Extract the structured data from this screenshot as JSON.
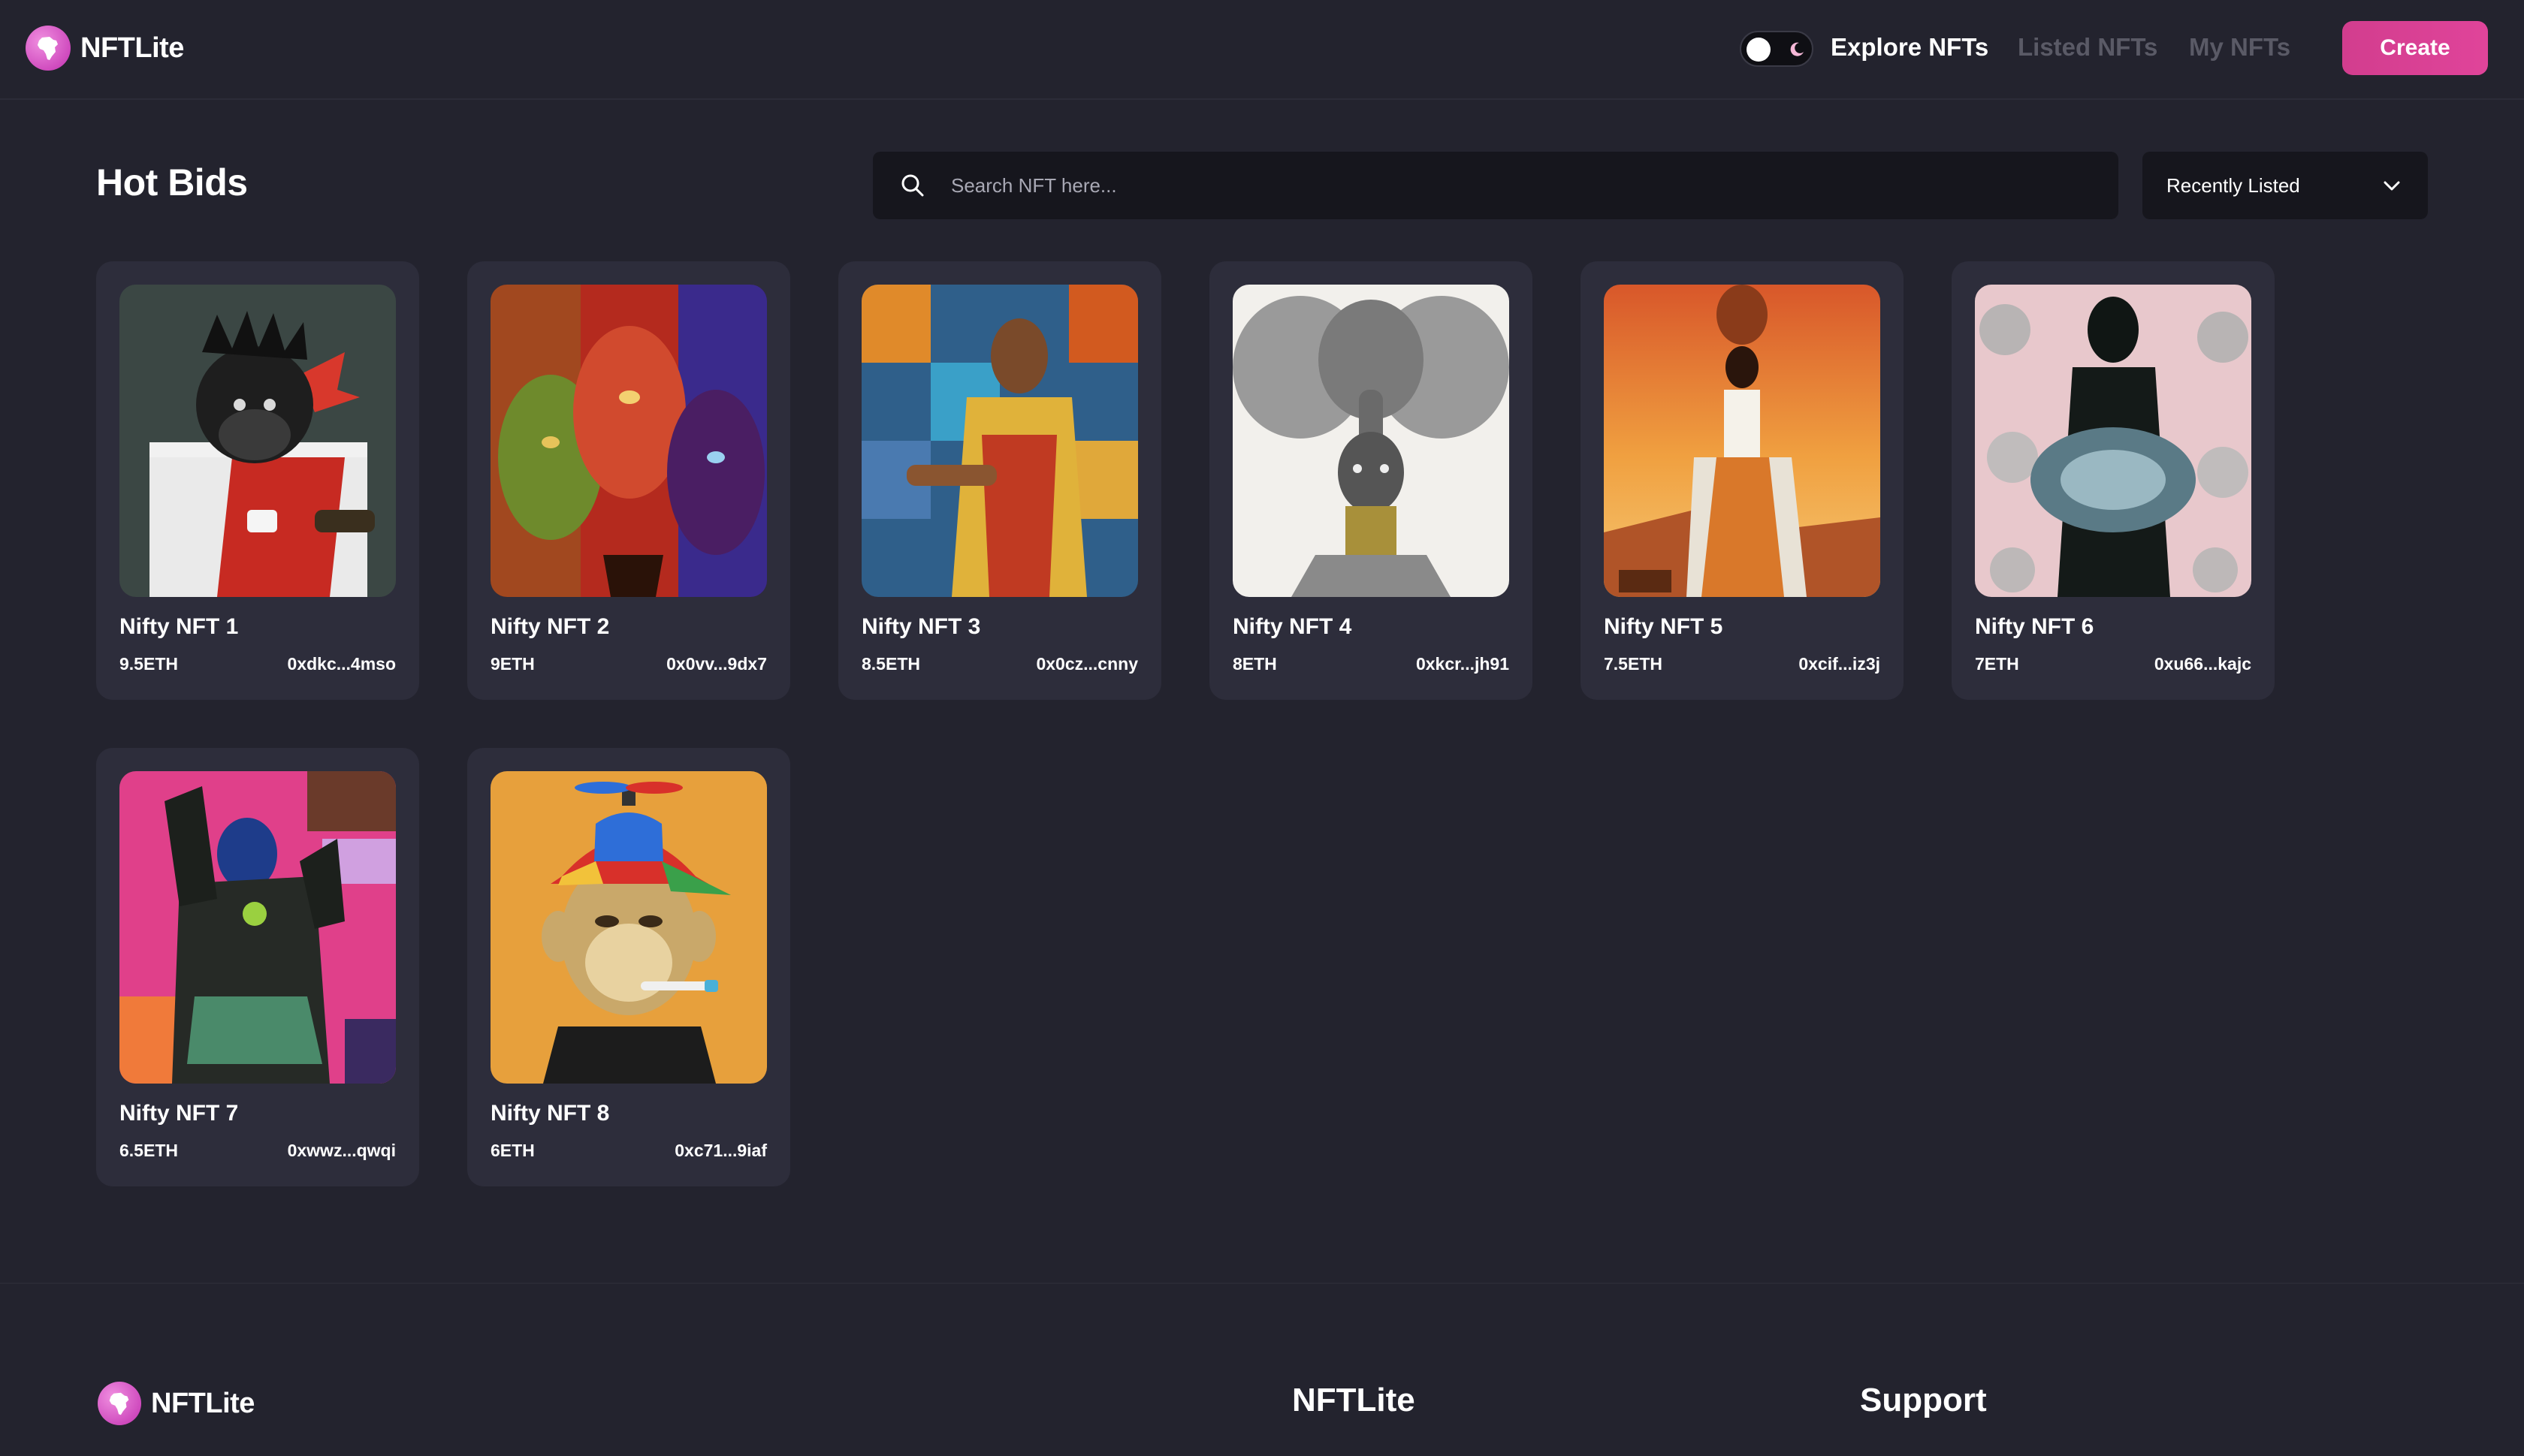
{
  "header": {
    "brand": "NFTLite",
    "nav": {
      "explore": "Explore NFTs",
      "listed": "Listed NFTs",
      "my": "My NFTs"
    },
    "create_label": "Create",
    "theme_toggle": "dark-mode-toggle"
  },
  "main": {
    "title": "Hot Bids",
    "search": {
      "placeholder": "Search NFT here...",
      "value": ""
    },
    "sort": {
      "selected": "Recently Listed"
    },
    "cards": [
      {
        "name": "Nifty NFT 1",
        "price": "9.5ETH",
        "owner": "0xdkc...4mso"
      },
      {
        "name": "Nifty NFT 2",
        "price": "9ETH",
        "owner": "0x0vv...9dx7"
      },
      {
        "name": "Nifty NFT 3",
        "price": "8.5ETH",
        "owner": "0x0cz...cnny"
      },
      {
        "name": "Nifty NFT 4",
        "price": "8ETH",
        "owner": "0xkcr...jh91"
      },
      {
        "name": "Nifty NFT 5",
        "price": "7.5ETH",
        "owner": "0xcif...iz3j"
      },
      {
        "name": "Nifty NFT 6",
        "price": "7ETH",
        "owner": "0xu66...kajc"
      },
      {
        "name": "Nifty NFT 7",
        "price": "6.5ETH",
        "owner": "0xwwz...qwqi"
      },
      {
        "name": "Nifty NFT 8",
        "price": "6ETH",
        "owner": "0xc71...9iaf"
      }
    ]
  },
  "footer": {
    "brand": "NFTLite",
    "headings": {
      "brand": "NFTLite",
      "support": "Support"
    }
  },
  "colors": {
    "background": "#23232e",
    "card": "#2d2d3b",
    "accent": "#d83f92",
    "muted_nav": "#5a5a66"
  },
  "icons": {
    "logo": "africa-logo-icon",
    "search": "search-icon",
    "chevron": "chevron-down-icon",
    "moon": "moon-icon"
  }
}
